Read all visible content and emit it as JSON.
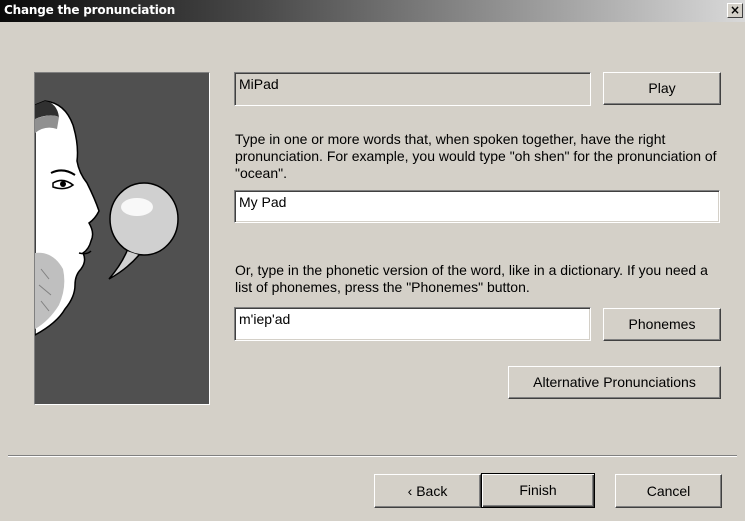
{
  "window": {
    "title": "Change the pronunciation",
    "close_glyph": "×"
  },
  "illustration": {
    "icon": "speaking-face-with-speech-balloon"
  },
  "word": {
    "value": "MiPad"
  },
  "buttons": {
    "play": "Play",
    "phonemes": "Phonemes",
    "alternatives": "Alternative Pronunciations",
    "back": "‹ Back",
    "finish": "Finish",
    "cancel": "Cancel"
  },
  "sounds_like": {
    "instructions": "Type in one or more words that, when spoken together, have the right pronunciation. For example, you would type \"oh shen\" for the pronunciation of \"ocean\".",
    "value": "My Pad"
  },
  "phonetic": {
    "instructions": "Or, type in the phonetic version of the word, like in a dictionary. If you need a list of phonemes, press the \"Phonemes\" button.",
    "value": "m'iep'ad"
  }
}
